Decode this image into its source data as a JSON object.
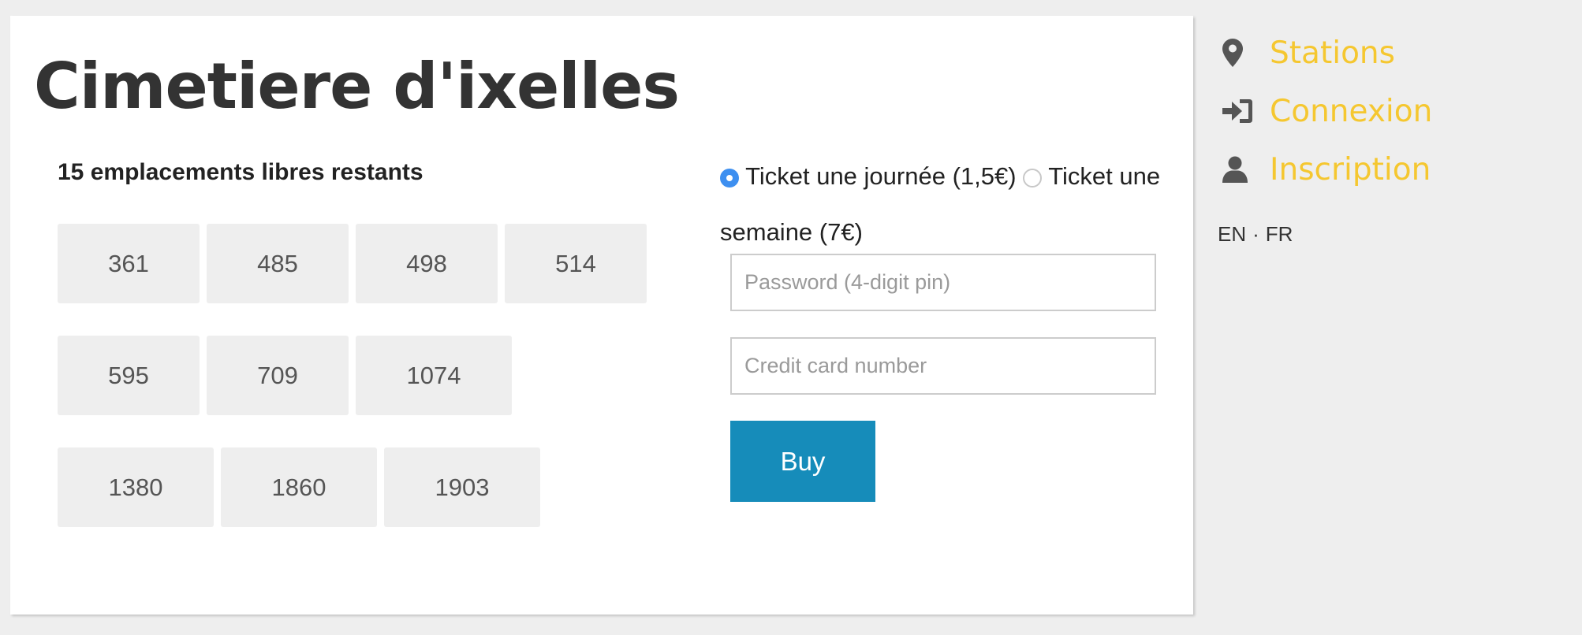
{
  "page": {
    "title": "Cimetiere d'ixelles"
  },
  "spots": {
    "count_label": "15 emplacements libres restants",
    "rows": [
      [
        "361",
        "485",
        "498",
        "514"
      ],
      [
        "595",
        "709",
        "1074"
      ],
      [
        "1380",
        "1860",
        "1903"
      ]
    ]
  },
  "ticket": {
    "option_day": "Ticket une journée (1,5€)",
    "option_week": "Ticket une semaine (7€)",
    "selected": "day"
  },
  "form": {
    "password_placeholder": "Password (4-digit pin)",
    "card_placeholder": "Credit card number",
    "password_value": "",
    "card_value": "",
    "buy_label": "Buy"
  },
  "nav": {
    "items": [
      {
        "label": "Stations",
        "icon": "map-marker-icon"
      },
      {
        "label": "Connexion",
        "icon": "sign-in-icon"
      },
      {
        "label": "Inscription",
        "icon": "user-icon"
      }
    ],
    "accent_color": "#f5c730",
    "icon_color": "#555555"
  },
  "lang": {
    "en": "EN",
    "separator": "·",
    "fr": "FR"
  },
  "colors": {
    "buy_button": "#168cba",
    "radio_selected": "#3d8ff0",
    "background": "#eeeeee"
  }
}
